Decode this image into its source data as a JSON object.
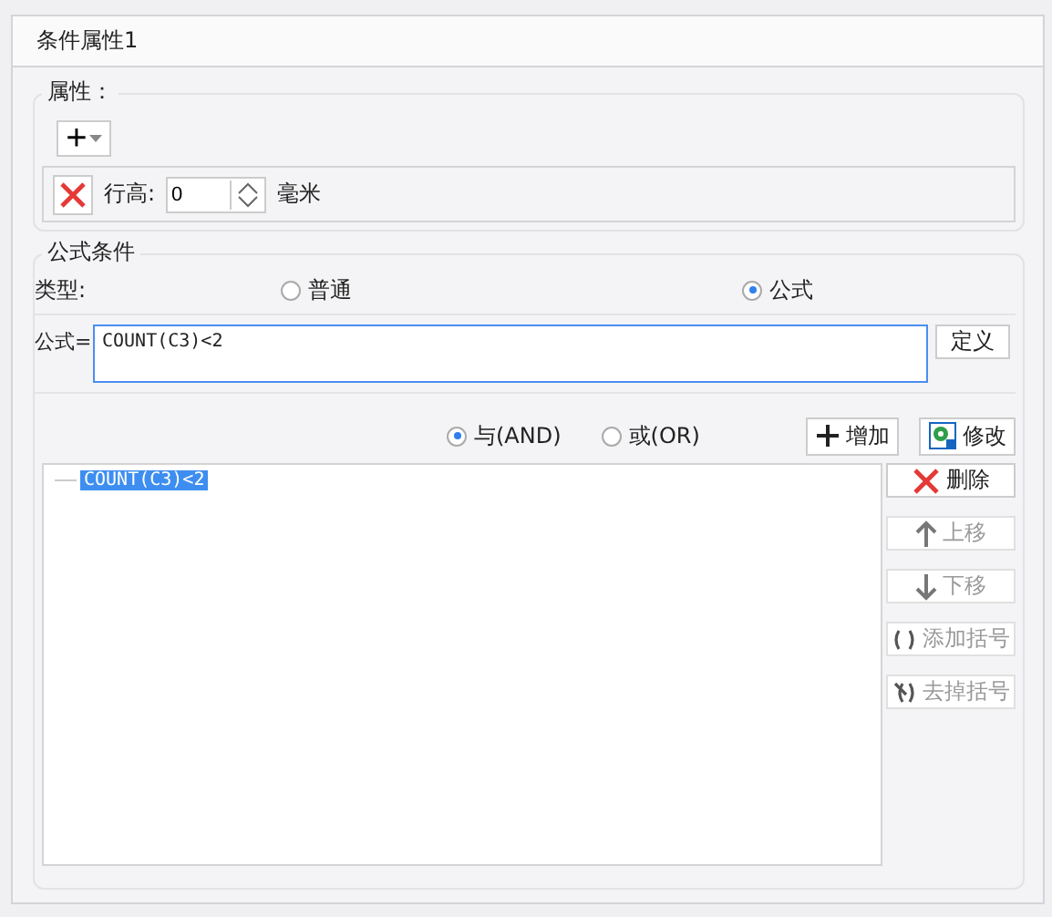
{
  "window": {
    "title": "条件属性1"
  },
  "attributes": {
    "legend": "属性：",
    "add_button": {
      "label": "+"
    },
    "row": {
      "label": "行高:",
      "value": "0",
      "unit": "毫米"
    }
  },
  "formula_condition": {
    "legend": "公式条件",
    "type_label": "类型:",
    "types": [
      {
        "label": "普通",
        "selected": false
      },
      {
        "label": "公式",
        "selected": true
      }
    ],
    "formula_label": "公式=",
    "formula_value": "COUNT(C3)<2",
    "define_button": "定义",
    "logic": [
      {
        "label": "与(AND)",
        "selected": true
      },
      {
        "label": "或(OR)",
        "selected": false
      }
    ],
    "actions": [
      {
        "kind": "add",
        "label": "增加"
      },
      {
        "kind": "edit",
        "label": "修改"
      }
    ],
    "conditions": [
      {
        "text": "COUNT(C3)<2",
        "selected": true
      }
    ],
    "side_buttons": [
      {
        "kind": "delete",
        "label": "删除",
        "disabled": false
      },
      {
        "kind": "up",
        "label": "上移",
        "disabled": true
      },
      {
        "kind": "down",
        "label": "下移",
        "disabled": true
      },
      {
        "kind": "add-bracket",
        "label": "添加括号",
        "disabled": true
      },
      {
        "kind": "remove-bracket",
        "label": "去掉括号",
        "disabled": true
      }
    ]
  }
}
